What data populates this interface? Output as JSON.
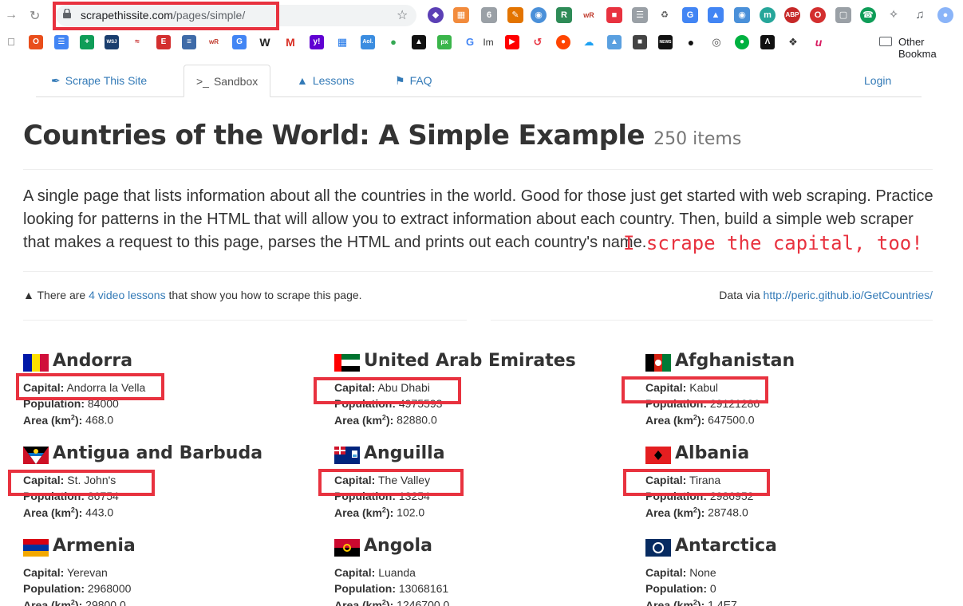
{
  "browser": {
    "url_host": "scrapethissite.com",
    "url_path": "/pages/simple/",
    "other_bookmarks": "Other Bookma"
  },
  "nav": {
    "brand": "Scrape This Site",
    "sandbox": "Sandbox",
    "lessons": "Lessons",
    "faq": "FAQ",
    "login": "Login"
  },
  "header": {
    "title": "Countries of the World: A Simple Example",
    "count": "250 items"
  },
  "lead": "A single page that lists information about all the countries in the world. Good for those just get started with web scraping. Practice looking for patterns in the HTML that will allow you to extract information about each country. Then, build a simple web scraper that makes a request to this page, parses the HTML and prints out each country's name.",
  "annotation": "I scrape the capital, too!",
  "video_note": {
    "prefix": "There are ",
    "link": "4 video lessons",
    "suffix": " that show you how to scrape this page."
  },
  "data_via": {
    "prefix": "Data via ",
    "link": "http://peric.github.io/GetCountries/"
  },
  "labels": {
    "capital": "Capital:",
    "population": "Population:",
    "area_pre": "Area (km",
    "area_sup": "2",
    "area_post": "):"
  },
  "countries": [
    {
      "name": "Andorra",
      "capital": "Andorra la Vella",
      "population": "84000",
      "area": "468.0"
    },
    {
      "name": "United Arab Emirates",
      "capital": "Abu Dhabi",
      "population": "4975593",
      "area": "82880.0"
    },
    {
      "name": "Afghanistan",
      "capital": "Kabul",
      "population": "29121286",
      "area": "647500.0"
    },
    {
      "name": "Antigua and Barbuda",
      "capital": "St. John's",
      "population": "86754",
      "area": "443.0"
    },
    {
      "name": "Anguilla",
      "capital": "The Valley",
      "population": "13254",
      "area": "102.0"
    },
    {
      "name": "Albania",
      "capital": "Tirana",
      "population": "2986952",
      "area": "28748.0"
    },
    {
      "name": "Armenia",
      "capital": "Yerevan",
      "population": "2968000",
      "area": "29800.0"
    },
    {
      "name": "Angola",
      "capital": "Luanda",
      "population": "13068161",
      "area": "1246700.0"
    },
    {
      "name": "Antarctica",
      "capital": "None",
      "population": "0",
      "area": "1.4E7"
    }
  ]
}
